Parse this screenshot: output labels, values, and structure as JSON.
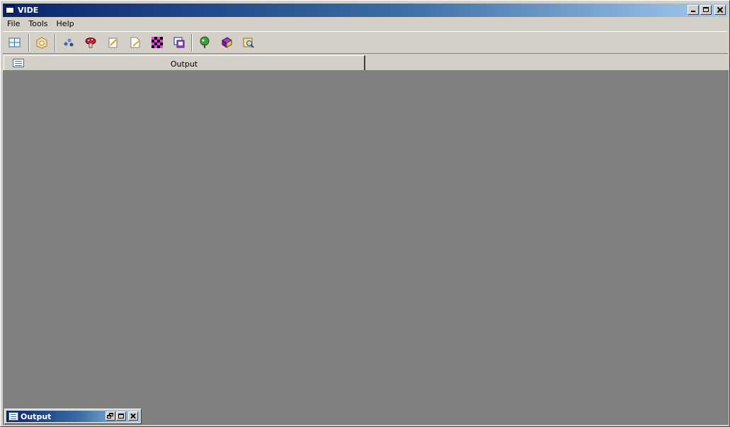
{
  "window": {
    "title": "VIDE"
  },
  "menu": {
    "items": [
      "File",
      "Tools",
      "Help"
    ]
  },
  "toolbar": {
    "icons": [
      "layout-icon",
      "open-icon",
      "molecules-icon",
      "mushroom-icon",
      "edit-icon",
      "edit-page-icon",
      "checker-icon",
      "windows-icon",
      "tree-icon",
      "book-icon",
      "inspect-icon"
    ]
  },
  "tab": {
    "label": "Output"
  },
  "minimized_window": {
    "title": "Output"
  },
  "colors": {
    "titlebar_start": "#0a246a",
    "titlebar_end": "#a6caf0",
    "desktop": "#808080",
    "face": "#d4d0c8"
  }
}
